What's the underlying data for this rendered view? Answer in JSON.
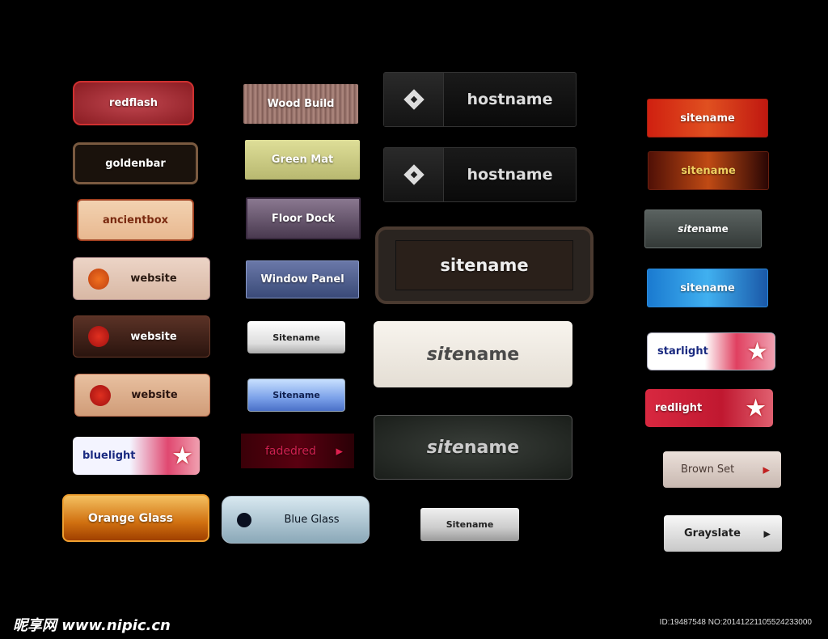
{
  "buttons": [
    {
      "label": "redflash"
    },
    {
      "label": "goldenbar"
    },
    {
      "label": "ancientbox"
    },
    {
      "label": "website",
      "icon": "dot"
    },
    {
      "label": "website",
      "icon": "dot"
    },
    {
      "label": "website",
      "icon": "dot"
    },
    {
      "label": "bluelight",
      "icon": "star"
    },
    {
      "label": "Orange Glass"
    },
    {
      "label": "Wood Build"
    },
    {
      "label": "Green Mat"
    },
    {
      "label": "Floor Dock"
    },
    {
      "label": "Window Panel"
    },
    {
      "label": "Sitename"
    },
    {
      "label": "Sitename"
    },
    {
      "label": "fadedred",
      "icon": "arrow"
    },
    {
      "label": "Blue Glass",
      "icon": "dot"
    },
    {
      "label": "hostname",
      "icon": "diamond"
    },
    {
      "label": "hostname",
      "icon": "diamond"
    },
    {
      "label": "sitename"
    },
    {
      "label": "name",
      "prefix": "site"
    },
    {
      "label": "name",
      "prefix": "site"
    },
    {
      "label": "Sitename"
    },
    {
      "label": "sitename"
    },
    {
      "label": "sitename"
    },
    {
      "label": "name",
      "prefix": "site"
    },
    {
      "label": "sitename"
    },
    {
      "label": "starlight",
      "icon": "star"
    },
    {
      "label": "redlight",
      "icon": "star"
    },
    {
      "label": "Brown Set",
      "icon": "arrow"
    },
    {
      "label": "Grayslate",
      "icon": "arrow"
    }
  ],
  "watermark": {
    "logo": "昵享网 www.nipic.cn",
    "id_text": "ID:19487548 NO:20141221105524233000"
  }
}
